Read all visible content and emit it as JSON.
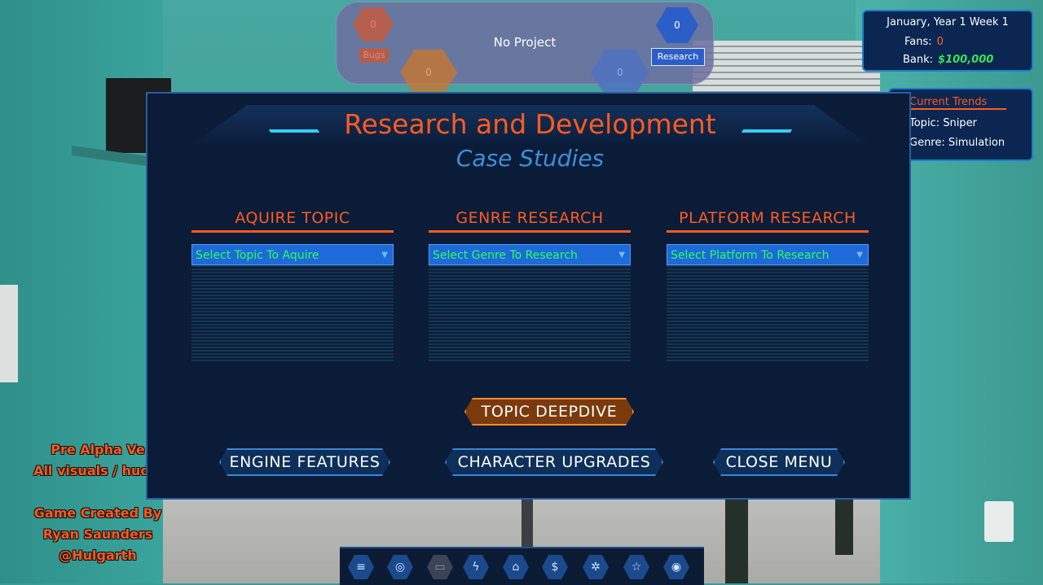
{
  "project_bar": {
    "title": "No Project",
    "bugs_count": "0",
    "bugs_label": "Bugs",
    "research_count": "0",
    "research_label": "Research",
    "design_count": "0",
    "tech_count": "0"
  },
  "status": {
    "date": "January, Year 1 Week 1",
    "fans_label": "Fans:",
    "fans_value": "0",
    "bank_label": "Bank:",
    "bank_value": "$100,000"
  },
  "trends": {
    "title": "Current Trends",
    "topic": "Topic: Sniper",
    "genre": "Genre: Simulation"
  },
  "dialog": {
    "title": "Research and Development",
    "subtitle": "Case Studies",
    "columns": [
      {
        "header": "AQUIRE TOPIC",
        "select": "Select Topic To Aquire"
      },
      {
        "header": "GENRE RESEARCH",
        "select": "Select Genre To Research"
      },
      {
        "header": "PLATFORM RESEARCH",
        "select": "Select Platform To Research"
      }
    ],
    "deep_button": "TOPIC DEEPDIVE",
    "engine_button": "ENGINE FEATURES",
    "character_button": "CHARACTER UPGRADES",
    "close_button": "CLOSE MENU"
  },
  "credits": {
    "line1": "Pre Alpha Ve",
    "line2": "All visuals / hud s",
    "line3": "Game Created By",
    "line4": "Ryan Saunders",
    "line5": "@Hulgarth"
  },
  "toolbar": {
    "icons": [
      "menu-icon",
      "globe-icon",
      "window-icon",
      "lightning-icon",
      "home-icon",
      "dollar-icon",
      "gear-icon",
      "star-icon",
      "target-icon"
    ],
    "glyphs": [
      "≡",
      "◎",
      "▭",
      "ϟ",
      "⌂",
      "$",
      "✲",
      "☆",
      "◉"
    ]
  },
  "colors": {
    "accent": "#ff5a1f",
    "panel": "#0b1c38",
    "select": "#1d6ad8",
    "select_text": "#2cff5a"
  }
}
